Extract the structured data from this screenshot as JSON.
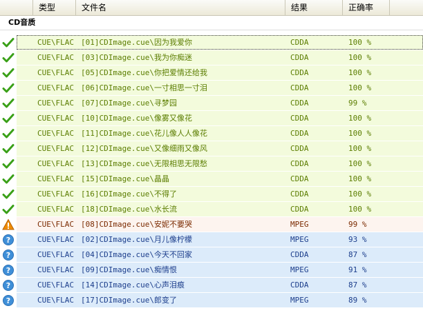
{
  "columns": {
    "type": "类型",
    "filename": "文件名",
    "result": "结果",
    "accuracy": "正确率"
  },
  "group": {
    "title": "CD音质"
  },
  "rows": [
    {
      "status": "ok",
      "icon": "check-icon",
      "type": "CUE\\FLAC",
      "file": "[01]CDImage.cue\\因为我爱你",
      "result": "CDDA",
      "rate": "100 %"
    },
    {
      "status": "ok",
      "icon": "check-icon",
      "type": "CUE\\FLAC",
      "file": "[03]CDImage.cue\\我为你痴迷",
      "result": "CDDA",
      "rate": "100 %"
    },
    {
      "status": "ok",
      "icon": "check-icon",
      "type": "CUE\\FLAC",
      "file": "[05]CDImage.cue\\你把爱情还给我",
      "result": "CDDA",
      "rate": "100 %"
    },
    {
      "status": "ok",
      "icon": "check-icon",
      "type": "CUE\\FLAC",
      "file": "[06]CDImage.cue\\一寸相思一寸泪",
      "result": "CDDA",
      "rate": "100 %"
    },
    {
      "status": "ok",
      "icon": "check-icon",
      "type": "CUE\\FLAC",
      "file": "[07]CDImage.cue\\寻梦园",
      "result": "CDDA",
      "rate": "99 %"
    },
    {
      "status": "ok",
      "icon": "check-icon",
      "type": "CUE\\FLAC",
      "file": "[10]CDImage.cue\\像雾又像花",
      "result": "CDDA",
      "rate": "100 %"
    },
    {
      "status": "ok",
      "icon": "check-icon",
      "type": "CUE\\FLAC",
      "file": "[11]CDImage.cue\\花儿像人人像花",
      "result": "CDDA",
      "rate": "100 %"
    },
    {
      "status": "ok",
      "icon": "check-icon",
      "type": "CUE\\FLAC",
      "file": "[12]CDImage.cue\\又像细雨又像风",
      "result": "CDDA",
      "rate": "100 %"
    },
    {
      "status": "ok",
      "icon": "check-icon",
      "type": "CUE\\FLAC",
      "file": "[13]CDImage.cue\\无限相思无限愁",
      "result": "CDDA",
      "rate": "100 %"
    },
    {
      "status": "ok",
      "icon": "check-icon",
      "type": "CUE\\FLAC",
      "file": "[15]CDImage.cue\\晶晶",
      "result": "CDDA",
      "rate": "100 %"
    },
    {
      "status": "ok",
      "icon": "check-icon",
      "type": "CUE\\FLAC",
      "file": "[16]CDImage.cue\\不得了",
      "result": "CDDA",
      "rate": "100 %"
    },
    {
      "status": "ok",
      "icon": "check-icon",
      "type": "CUE\\FLAC",
      "file": "[18]CDImage.cue\\水长流",
      "result": "CDDA",
      "rate": "100 %"
    },
    {
      "status": "warn",
      "icon": "warning-icon",
      "type": "CUE\\FLAC",
      "file": "[08]CDImage.cue\\安妮不要哭",
      "result": "MPEG",
      "rate": "99 %"
    },
    {
      "status": "info",
      "icon": "question-icon",
      "type": "CUE\\FLAC",
      "file": "[02]CDImage.cue\\月儿像柠檬",
      "result": "MPEG",
      "rate": "93 %"
    },
    {
      "status": "info",
      "icon": "question-icon",
      "type": "CUE\\FLAC",
      "file": "[04]CDImage.cue\\今天不回家",
      "result": "CDDA",
      "rate": "87 %"
    },
    {
      "status": "info",
      "icon": "question-icon",
      "type": "CUE\\FLAC",
      "file": "[09]CDImage.cue\\痴情恨",
      "result": "MPEG",
      "rate": "91 %"
    },
    {
      "status": "info",
      "icon": "question-icon",
      "type": "CUE\\FLAC",
      "file": "[14]CDImage.cue\\心声泪痕",
      "result": "CDDA",
      "rate": "87 %"
    },
    {
      "status": "info",
      "icon": "question-icon",
      "type": "CUE\\FLAC",
      "file": "[17]CDImage.cue\\郎变了",
      "result": "MPEG",
      "rate": "89 %"
    }
  ],
  "colors": {
    "ok_row_bg": "#f3fbdc",
    "warn_row_bg": "#fdf4ef",
    "info_row_bg": "#dcebfa",
    "ok_text": "#5b7d00",
    "warn_text": "#7a2a00",
    "info_text": "#1c3e8c",
    "check_green": "#3aa018",
    "warning_orange": "#f08c00",
    "question_blue": "#3f8fd8"
  }
}
